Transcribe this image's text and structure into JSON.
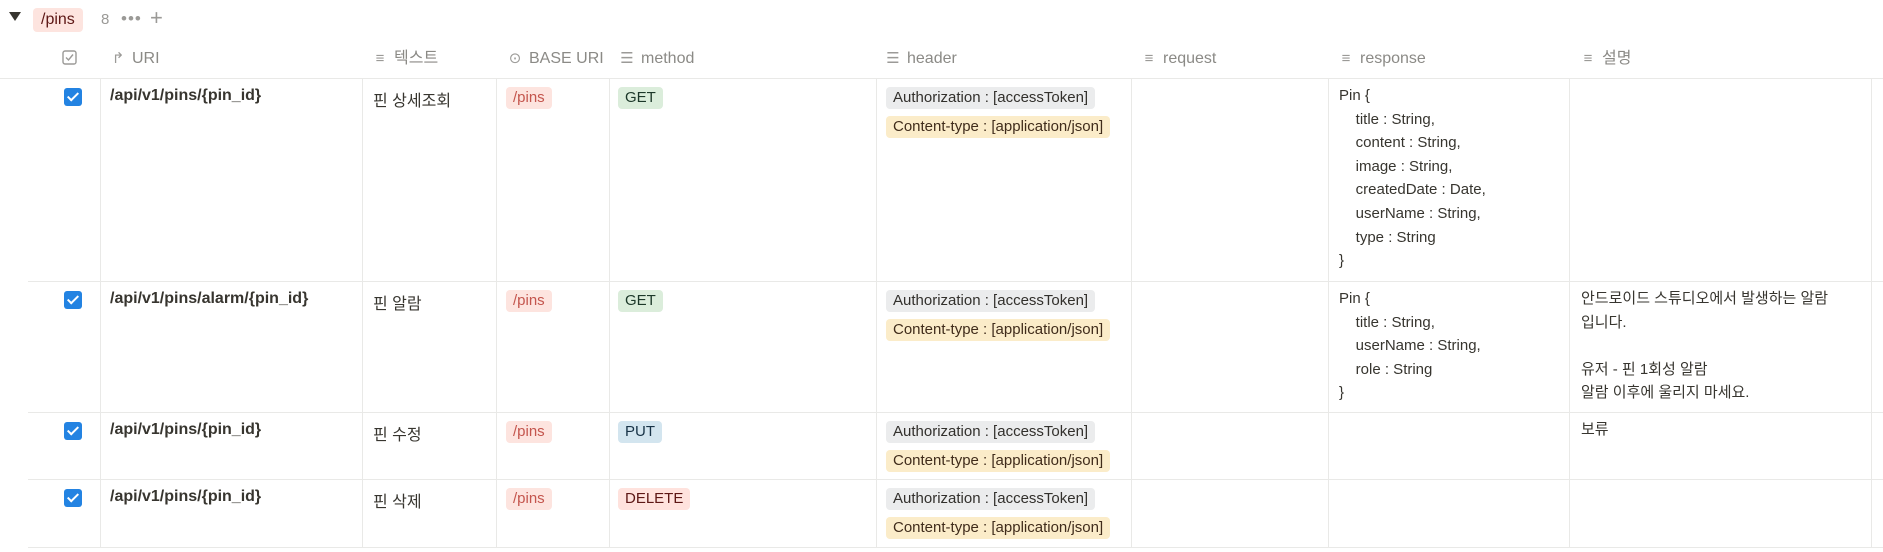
{
  "group": {
    "tag": "/pins",
    "count": "8",
    "more_icon": "ellipsis-icon",
    "add_icon": "plus-icon"
  },
  "columns": {
    "uri": "URI",
    "text": "텍스트",
    "base_uri": "BASE URI",
    "method": "method",
    "header": "header",
    "request": "request",
    "response": "response",
    "desc": "설명"
  },
  "rows": [
    {
      "uri": "/api/v1/pins/{pin_id}",
      "text": "핀 상세조회",
      "base": "/pins",
      "method": "GET",
      "auth": "Authorization : [accessToken]",
      "ct": "Content-type : [application/json]",
      "response": "Pin {\n    title : String,\n    content : String,\n    image : String,\n    createdDate : Date,\n    userName : String,\n    type : String\n}",
      "desc": ""
    },
    {
      "uri": "/api/v1/pins/alarm/{pin_id}",
      "text": "핀 알람",
      "base": "/pins",
      "method": "GET",
      "auth": "Authorization : [accessToken]",
      "ct": "Content-type : [application/json]",
      "response": "Pin {\n    title : String,\n    userName : String,\n    role : String\n}",
      "desc": "안드로이드 스튜디오에서 발생하는 알람\n입니다.\n\n유저 - 핀 1회성 알람\n알람 이후에 울리지 마세요."
    },
    {
      "uri": "/api/v1/pins/{pin_id}",
      "text": "핀 수정",
      "base": "/pins",
      "method": "PUT",
      "auth": "Authorization : [accessToken]",
      "ct": "Content-type : [application/json]",
      "response": "",
      "desc": "보류"
    },
    {
      "uri": "/api/v1/pins/{pin_id}",
      "text": "핀 삭제",
      "base": "/pins",
      "method": "DELETE",
      "auth": "Authorization : [accessToken]",
      "ct": "Content-type : [application/json]",
      "response": "",
      "desc": ""
    }
  ]
}
